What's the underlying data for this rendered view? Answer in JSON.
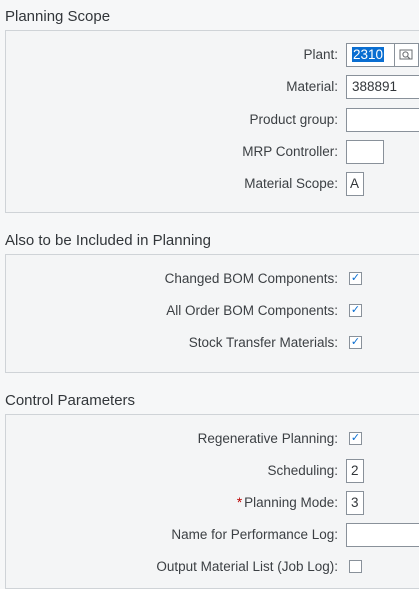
{
  "planning_scope": {
    "title": "Planning Scope",
    "plant_label": "Plant:",
    "plant_value": "2310",
    "material_label": "Material:",
    "material_value": "388891",
    "product_group_label": "Product group:",
    "product_group_value": "",
    "mrp_controller_label": "MRP Controller:",
    "mrp_controller_value": "",
    "material_scope_label": "Material Scope:",
    "material_scope_value": "A"
  },
  "also_included": {
    "title": "Also to be Included in Planning",
    "changed_bom_label": "Changed BOM Components:",
    "changed_bom_checked": "✓",
    "all_order_bom_label": "All Order BOM Components:",
    "all_order_bom_checked": "✓",
    "stock_transfer_label": "Stock Transfer Materials:",
    "stock_transfer_checked": "✓"
  },
  "control_parameters": {
    "title": "Control Parameters",
    "regenerative_label": "Regenerative Planning:",
    "regenerative_checked": "✓",
    "scheduling_label": "Scheduling:",
    "scheduling_value": "2",
    "planning_mode_required": "*",
    "planning_mode_label": "Planning Mode:",
    "planning_mode_value": "3",
    "perf_log_label": "Name for Performance Log:",
    "perf_log_value": "",
    "output_list_label": "Output Material List (Job Log):",
    "output_list_checked": ""
  },
  "icons": {
    "value_help": "value-help-icon",
    "checkmark": "checkmark-icon"
  },
  "colors": {
    "accent": "#0a6ed1",
    "required": "#bb0000",
    "border": "#89919a"
  }
}
